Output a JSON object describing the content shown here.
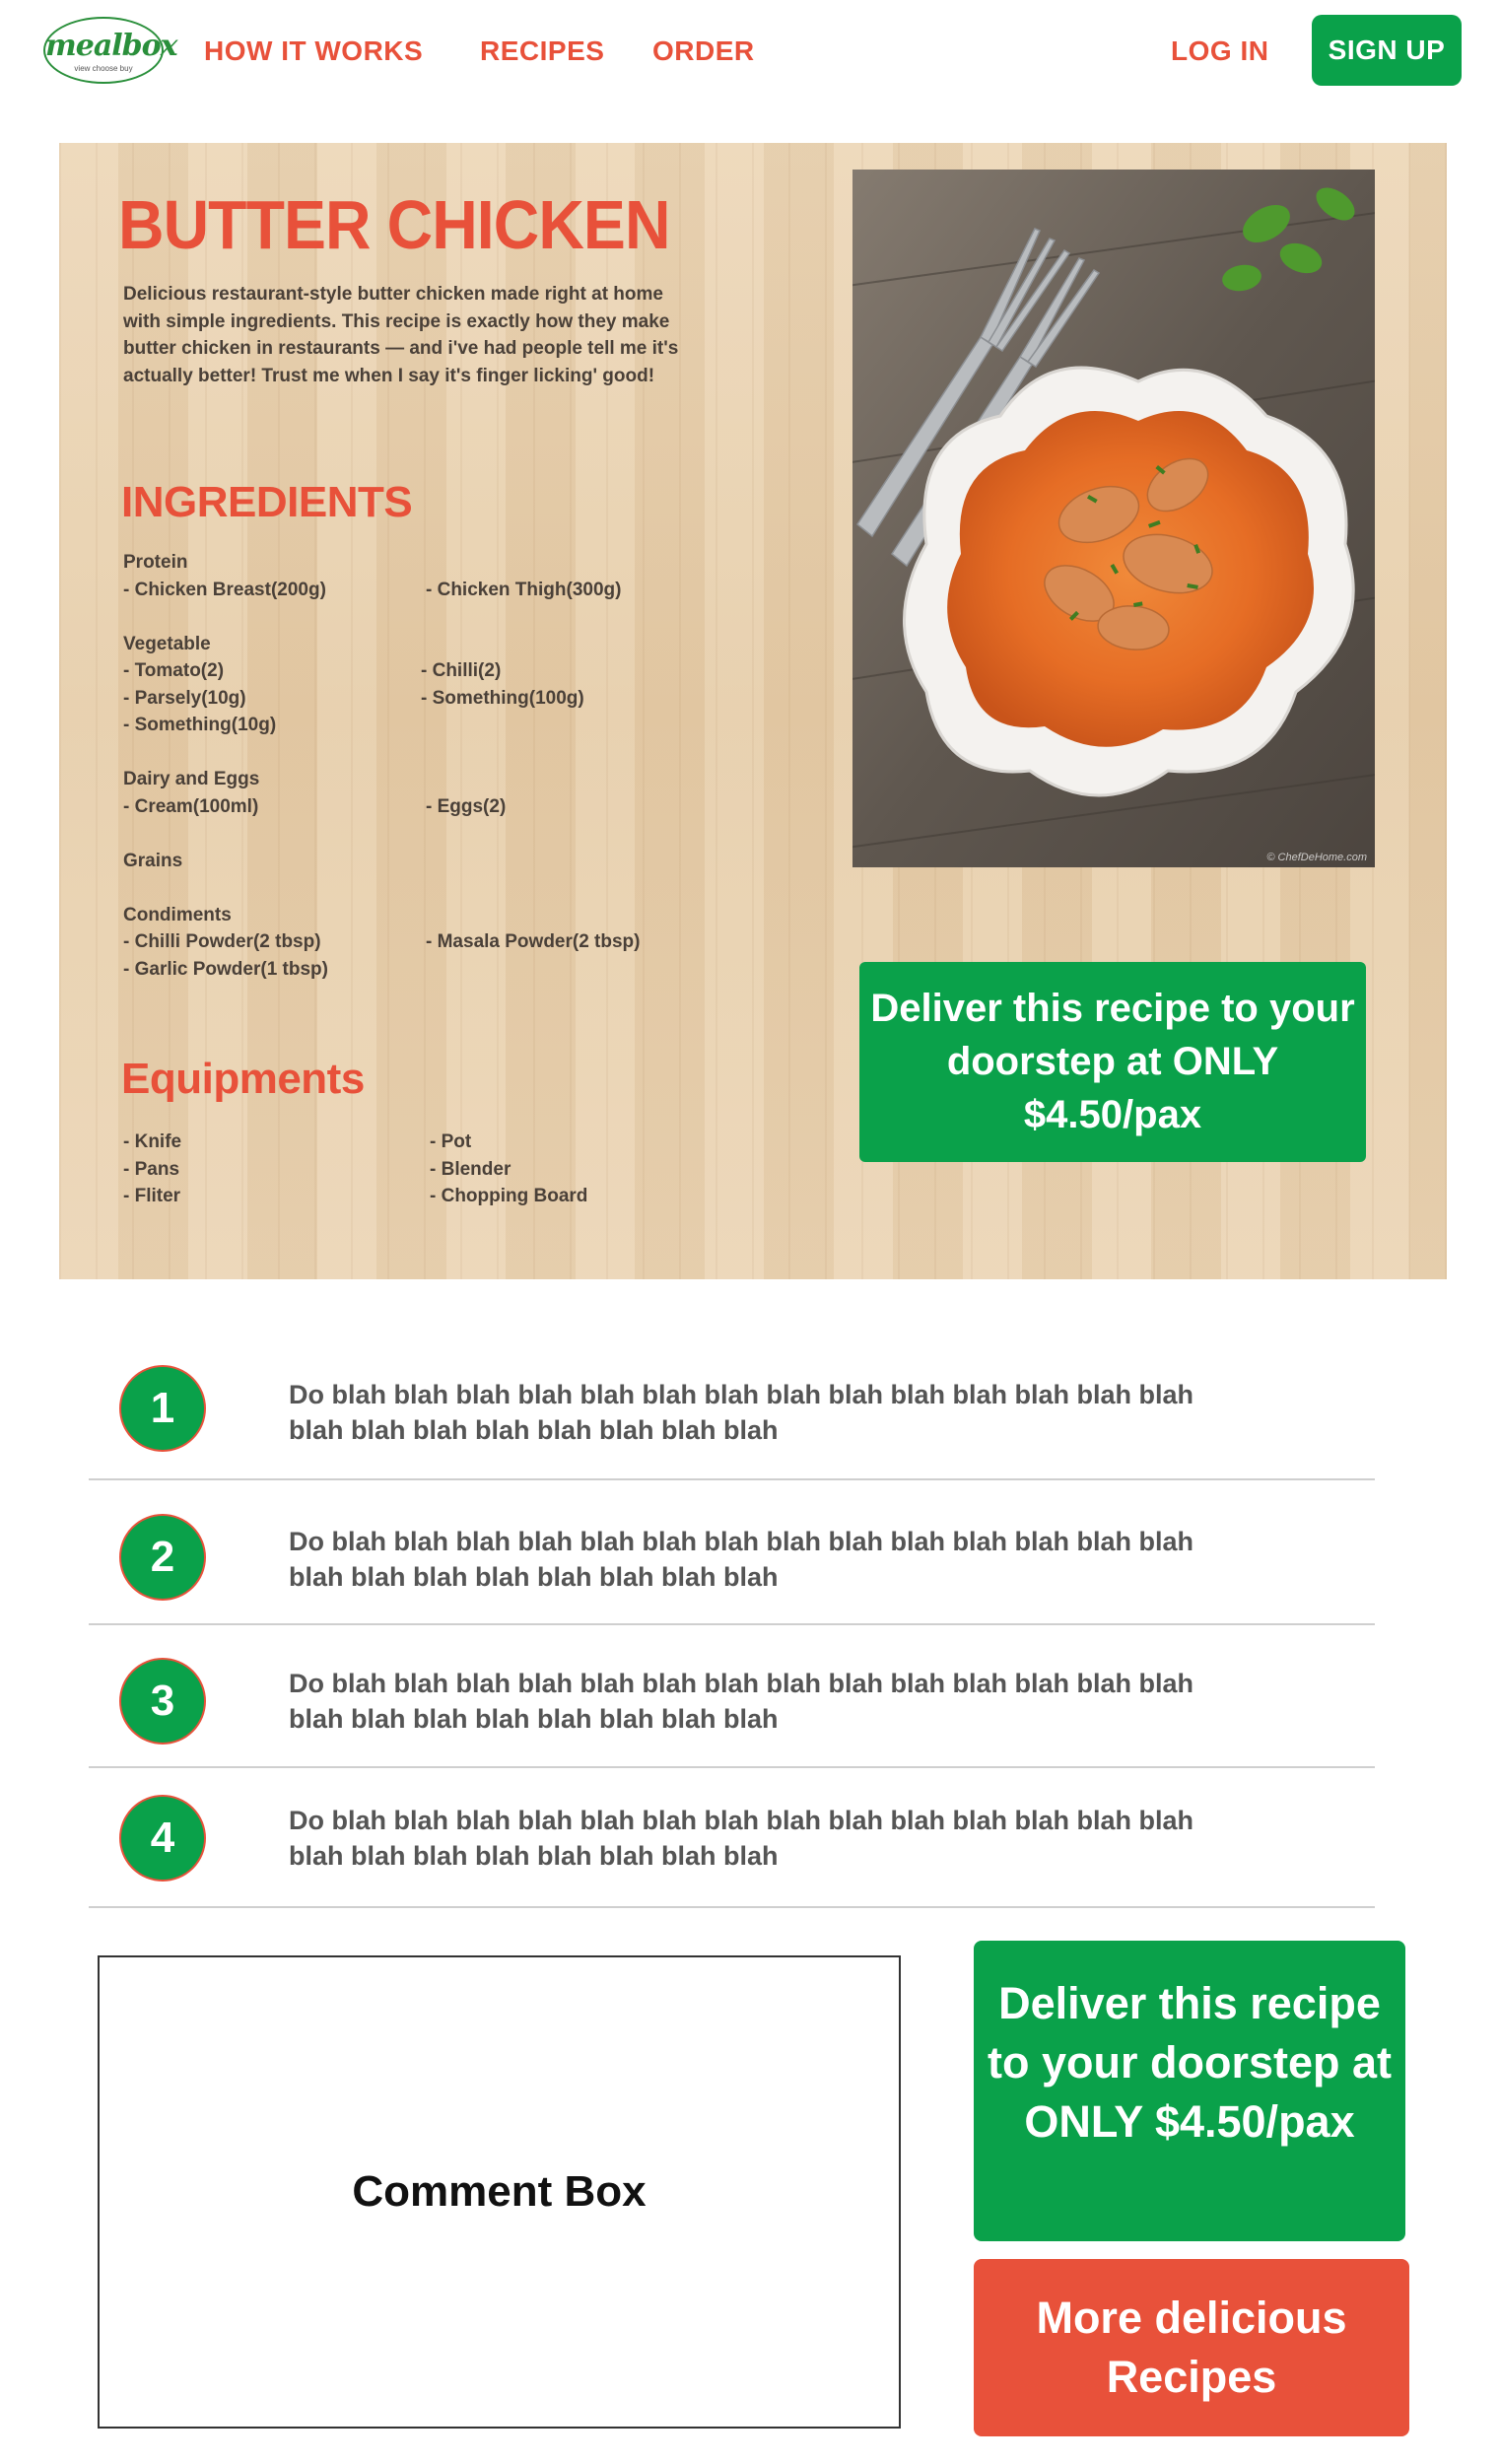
{
  "nav": {
    "logo_text": "mealbox",
    "logo_tagline": "view choose buy",
    "links": [
      "HOW IT WORKS",
      "RECIPES",
      "ORDER"
    ],
    "login": "LOG IN",
    "signup": "SIGN UP"
  },
  "recipe": {
    "title": "BUTTER CHICKEN",
    "description": "Delicious restaurant-style butter chicken made right at home with simple ingredients. This recipe is exactly how they make butter chicken in restaurants — and i've had people tell me it's actually better! Trust me when I say it's finger licking' good!",
    "ingredients_heading": "INGREDIENTS",
    "ingredient_groups": [
      {
        "name": "Protein",
        "rows": [
          [
            "- Chicken Breast(200g)",
            "- Chicken Thigh(300g)"
          ]
        ]
      },
      {
        "name": "Vegetable",
        "rows": [
          [
            "- Tomato(2)",
            "- Chilli(2)"
          ],
          [
            "- Parsely(10g)",
            "- Something(100g)"
          ],
          [
            "- Something(10g)",
            ""
          ]
        ]
      },
      {
        "name": "Dairy and Eggs",
        "rows": [
          [
            "- Cream(100ml)",
            "- Eggs(2)"
          ]
        ]
      },
      {
        "name": "Grains",
        "rows": []
      },
      {
        "name": "Condiments",
        "rows": [
          [
            "- Chilli Powder(2 tbsp)",
            "- Masala Powder(2 tbsp)"
          ],
          [
            "- Garlic Powder(1 tbsp)",
            ""
          ]
        ]
      }
    ],
    "equipment_heading": "Equipments",
    "equipment_rows": [
      [
        "- Knife",
        "- Pot"
      ],
      [
        "- Pans",
        "- Blender"
      ],
      [
        "- Fliter",
        "- Chopping Board"
      ]
    ],
    "photo_credit": "© ChefDeHome.com",
    "deliver_button": "Deliver this recipe to your doorstep at ONLY $4.50/pax"
  },
  "steps": [
    {
      "number": "1",
      "text": "Do blah blah blah blah blah blah blah blah blah blah blah blah blah blah blah blah blah blah blah blah blah blah"
    },
    {
      "number": "2",
      "text": "Do blah blah blah blah blah blah blah blah blah blah blah blah blah blah blah blah blah blah blah blah blah blah"
    },
    {
      "number": "3",
      "text": "Do blah blah blah blah blah blah blah blah blah blah blah blah blah blah blah blah blah blah blah blah blah blah"
    },
    {
      "number": "4",
      "text": "Do blah blah blah blah blah blah blah blah blah blah blah blah blah blah blah blah blah blah blah blah blah blah"
    }
  ],
  "bottom": {
    "comment_box": "Comment Box",
    "deliver_button": "Deliver this recipe to your doorstep at ONLY $4.50/pax",
    "more_recipes_button": "More delicious Recipes"
  },
  "colors": {
    "brand_red": "#e8513a",
    "brand_green": "#0aa14a",
    "text_brown": "#4a4038"
  }
}
